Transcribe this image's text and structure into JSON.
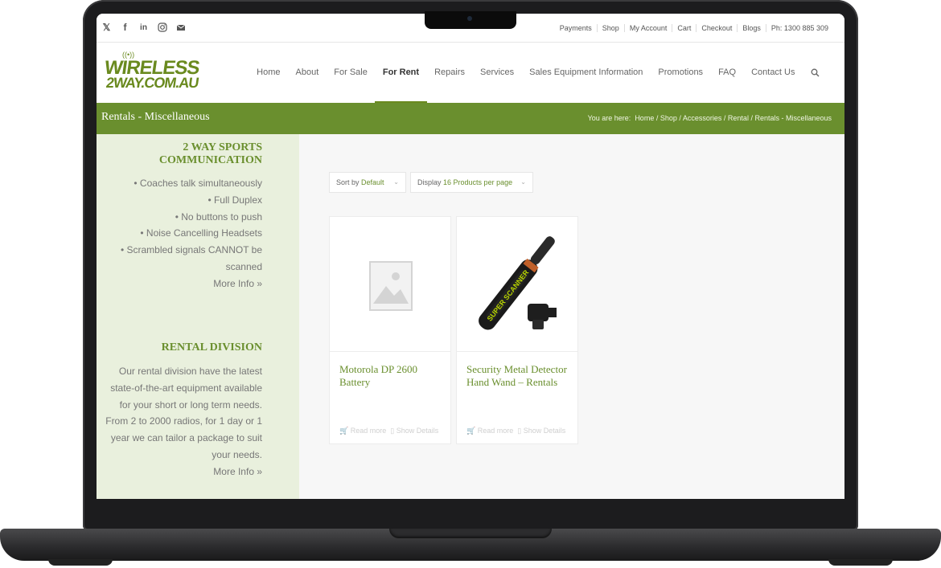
{
  "social": [
    "x-icon",
    "facebook-icon",
    "linkedin-icon",
    "instagram-icon",
    "mail-icon"
  ],
  "toplinks": [
    "Payments",
    "Shop",
    "My Account",
    "Cart",
    "Checkout",
    "Blogs",
    "Ph: 1300 885 309"
  ],
  "logo": {
    "line1": "WIRELESS",
    "line2": "2WAY.COM.AU"
  },
  "nav": {
    "items": [
      "Home",
      "About",
      "For Sale",
      "For Rent",
      "Repairs",
      "Services",
      "Sales Equipment Information",
      "Promotions",
      "FAQ",
      "Contact Us"
    ],
    "active": "For Rent"
  },
  "page_title": "Rentals - Miscellaneous",
  "breadcrumb": {
    "prefix": "You are here:",
    "items": [
      "Home",
      "Shop",
      "Accessories",
      "Rental",
      "Rentals - Miscellaneous"
    ]
  },
  "sidebar": {
    "block1": {
      "heading_line1": "2 WAY SPORTS",
      "heading_line2": "COMMUNICATION",
      "lines": [
        "• Coaches talk simultaneously",
        "• Full Duplex",
        "• No buttons to push",
        "• Noise Cancelling Headsets",
        "• Scrambled signals CANNOT be",
        "scanned"
      ],
      "more": "More Info »"
    },
    "block2": {
      "heading": "RENTAL DIVISION",
      "lines": [
        "Our rental division have the latest",
        "state-of-the-art equipment available",
        "for your short or long term needs.",
        "From 2 to 2000 radios, for 1 day or 1",
        "year we can tailor a package to suit",
        "your needs."
      ],
      "more": "More Info »"
    }
  },
  "sort": {
    "label": "Sort by",
    "value": "Default"
  },
  "display": {
    "label": "Display",
    "value": "16 Products per page"
  },
  "products": [
    {
      "name": "Motorola DP 2600 Battery",
      "read_more": "Read more",
      "show_details": "Show Details"
    },
    {
      "name": "Security Metal Detector Hand Wand – Rentals",
      "read_more": "Read more",
      "show_details": "Show Details",
      "image_text": "SUPER SCANNER"
    }
  ],
  "colors": {
    "brand_green": "#6a8f2e",
    "sidebar_bg": "#e9f0dd",
    "frame": "#1c1c1e"
  }
}
